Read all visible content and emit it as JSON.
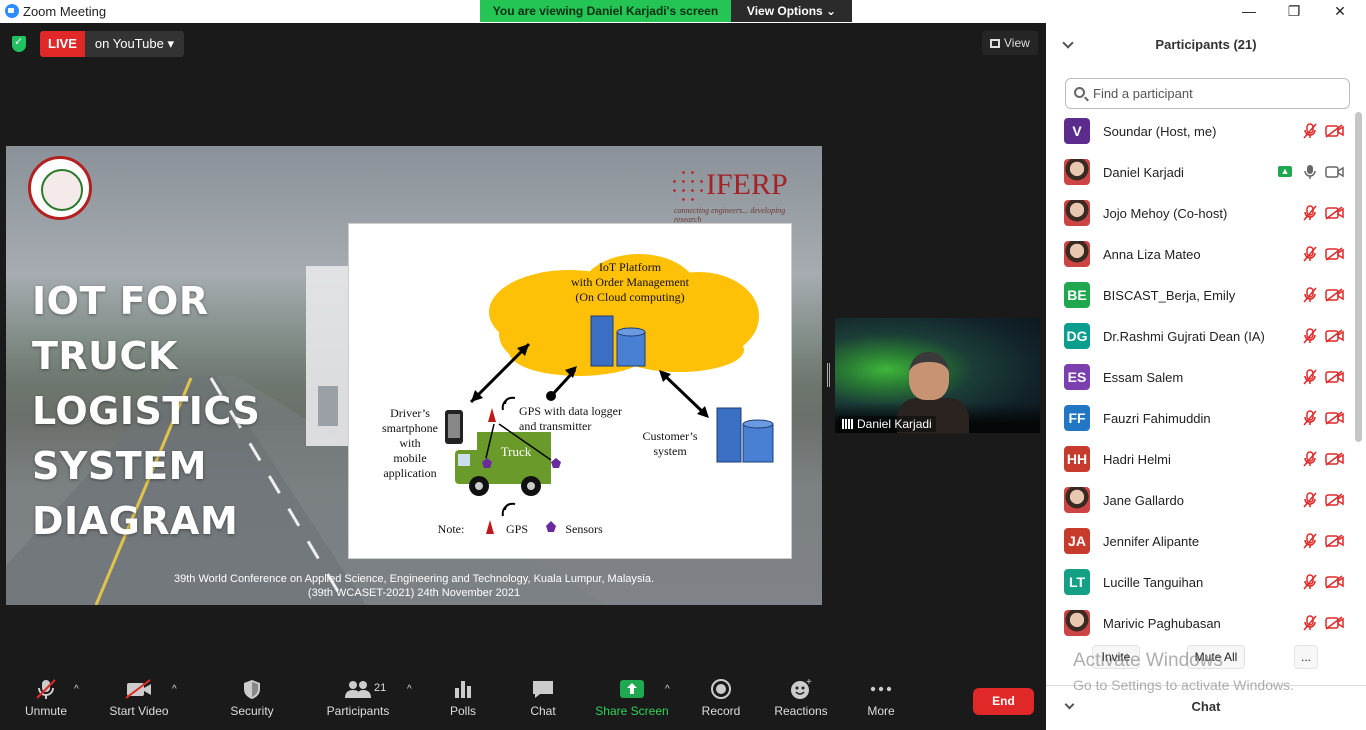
{
  "window": {
    "title": "Zoom Meeting",
    "minimize": "—",
    "maximize": "❐",
    "close": "✕"
  },
  "banner": {
    "viewing": "You are viewing Daniel Karjadi's screen",
    "view_options": "View Options ⌄"
  },
  "live": {
    "badge": "LIVE",
    "target": "on YouTube ▾"
  },
  "view_button": {
    "label": "View"
  },
  "slide": {
    "title_lines": [
      "IOT FOR TRUCK",
      "LOGISTICS",
      "SYSTEM",
      "DIAGRAM"
    ],
    "logo_text": "IFERP",
    "logo_tagline": "connecting engineers... developing research",
    "diagram": {
      "cloud": "IoT Platform\nwith Order Management\n(On Cloud computing)",
      "driver": "Driver’s\nsmartphone\nwith\nmobile\napplication",
      "gps_logger": "GPS with data logger\nand transmitter",
      "truck": "Truck",
      "customer": "Customer’s\nsystem",
      "note": "Note:",
      "gps": "GPS",
      "sensors": "Sensors"
    },
    "footer_line1": "39th World Conference on Applied Science, Engineering and Technology, Kuala Lumpur, Malaysia.",
    "footer_line2": "(39th WCASET-2021) 24th November 2021"
  },
  "speaker": {
    "name": "Daniel Karjadi"
  },
  "toolbar": {
    "unmute": "Unmute",
    "start_video": "Start Video",
    "security": "Security",
    "participants": "Participants",
    "participants_count": "21",
    "polls": "Polls",
    "chat": "Chat",
    "share_screen": "Share Screen",
    "record": "Record",
    "reactions": "Reactions",
    "more": "More",
    "end": "End"
  },
  "panel": {
    "header": "Participants (21)",
    "search_placeholder": "Find a participant",
    "participants": [
      {
        "initials": "V",
        "name": "Soundar (Host, me)",
        "color": "#5b2c8e",
        "photo": false
      },
      {
        "initials": "",
        "name": "Daniel Karjadi",
        "color": "#c0272d",
        "photo": true,
        "sharing": true
      },
      {
        "initials": "",
        "name": "Jojo Mehoy (Co-host)",
        "color": "#666",
        "photo": true
      },
      {
        "initials": "",
        "name": "Anna Liza Mateo",
        "color": "#a33",
        "photo": true
      },
      {
        "initials": "BE",
        "name": "BISCAST_Berja, Emily",
        "color": "#1fa84f",
        "photo": false
      },
      {
        "initials": "DG",
        "name": "Dr.Rashmi Gujrati Dean (IA)",
        "color": "#0b9e8f",
        "photo": false
      },
      {
        "initials": "ES",
        "name": "Essam Salem",
        "color": "#7b3fb0",
        "photo": false
      },
      {
        "initials": "FF",
        "name": "Fauzri Fahimuddin",
        "color": "#2277c4",
        "photo": false
      },
      {
        "initials": "HH",
        "name": "Hadri Helmi",
        "color": "#c63b2c",
        "photo": false
      },
      {
        "initials": "",
        "name": "Jane Gallardo",
        "color": "#b44",
        "photo": true
      },
      {
        "initials": "JA",
        "name": "Jennifer Alipante",
        "color": "#c63b2c",
        "photo": false
      },
      {
        "initials": "LT",
        "name": "Lucille Tanguihan",
        "color": "#14a085",
        "photo": false
      },
      {
        "initials": "",
        "name": "Marivic Paghubasan",
        "color": "#a33",
        "photo": true
      }
    ],
    "invite": "Invite",
    "mute_all": "Mute All",
    "more": "...",
    "chat_header": "Chat"
  },
  "watermark": {
    "line1": "Activate Windows",
    "line2": "Go to Settings to activate Windows."
  }
}
